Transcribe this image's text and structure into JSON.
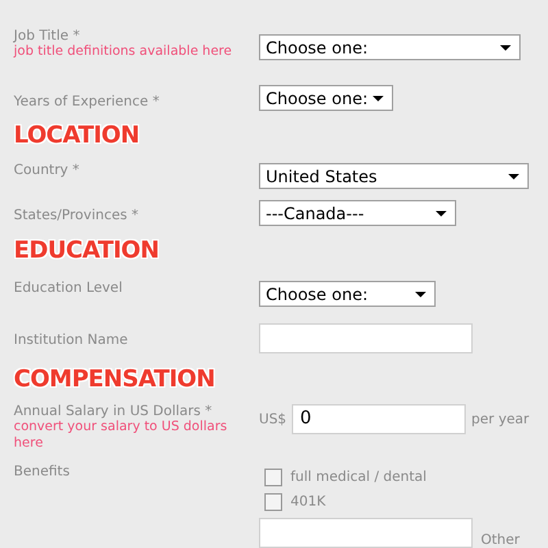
{
  "sections": [
    {
      "fields": [
        {
          "kind": "select",
          "label": "Job Title *",
          "link": "job title definitions available here",
          "value": "Choose one:"
        },
        {
          "kind": "select",
          "label": "Years of Experience *",
          "value": "Choose one:"
        }
      ]
    },
    {
      "heading": "LOCATION",
      "fields": [
        {
          "kind": "select",
          "label": "Country *",
          "value": "United States"
        },
        {
          "kind": "select",
          "label": "States/Provinces *",
          "value": "---Canada---"
        }
      ]
    },
    {
      "heading": "EDUCATION",
      "fields": [
        {
          "kind": "select",
          "label": "Education Level",
          "value": "Choose one:"
        },
        {
          "kind": "text",
          "label": "Institution Name"
        }
      ]
    },
    {
      "heading": "COMPENSATION",
      "fields": [
        {
          "kind": "money",
          "label": "Annual Salary in US Dollars *",
          "link": "convert your salary to US dollars here",
          "prefix": "US$",
          "value": "0",
          "suffix": "per year"
        },
        {
          "kind": "checkboxes",
          "label": "Benefits",
          "options": [
            {
              "label": "full medical / dental",
              "checked": false
            },
            {
              "label": "401K",
              "checked": false
            }
          ],
          "other": "Other"
        }
      ]
    }
  ]
}
